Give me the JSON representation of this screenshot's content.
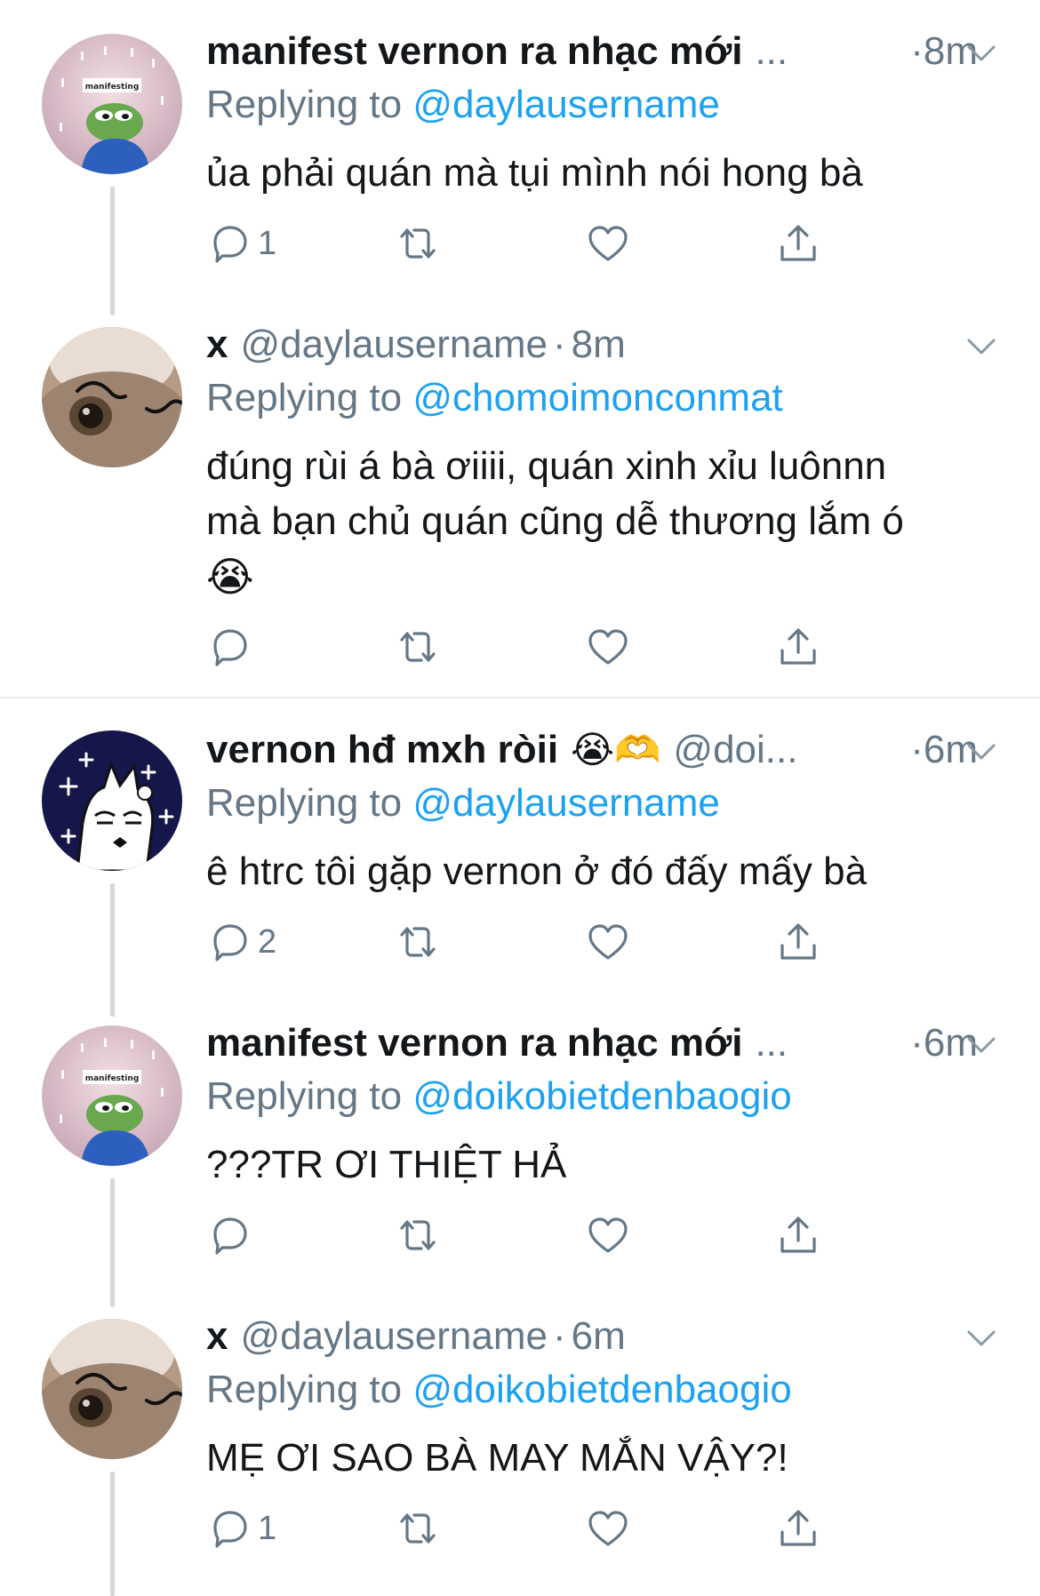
{
  "tweets": [
    {
      "name": "manifest vernon ra nhạc mới",
      "ellipsis": "...",
      "handle": "",
      "time": "8m",
      "replying_label": "Replying to",
      "replying_to": "@daylausername",
      "text": "ủa phải quán mà tụi mình nói hong bà",
      "reply_count": "1",
      "avatar": "pepe-manifesting-avatar",
      "avatar_label": "manifesting"
    },
    {
      "name": "x",
      "handle": "@daylausername",
      "time": "8m",
      "replying_label": "Replying to",
      "replying_to": "@chomoimonconmat",
      "text_line1": "đúng rùi á bà ơiiii, quán xinh xỉu luônnn",
      "text_line2": "mà bạn chủ quán cũng dễ thương lắm ó",
      "text_emoji": "😭",
      "reply_count": "",
      "avatar": "cat-avatar"
    },
    {
      "name": "vernon hđ mxh ròii",
      "name_emojis": "😭🫶",
      "handle": "@doi...",
      "time": "6m",
      "replying_label": "Replying to",
      "replying_to": "@daylausername",
      "text": "ê htrc tôi gặp vernon ở đó đấy mấy bà",
      "reply_count": "2",
      "avatar": "cartoon-girl-avatar"
    },
    {
      "name": "manifest vernon ra nhạc mới",
      "ellipsis": "...",
      "handle": "",
      "time": "6m",
      "replying_label": "Replying to",
      "replying_to": "@doikobietdenbaogio",
      "text": "???TR ƠI THIỆT HẢ",
      "reply_count": "",
      "avatar": "pepe-manifesting-avatar",
      "avatar_label": "manifesting"
    },
    {
      "name": "x",
      "handle": "@daylausername",
      "time": "6m",
      "replying_label": "Replying to",
      "replying_to": "@doikobietdenbaogio",
      "text": "MẸ ƠI SAO BÀ MAY MẮN VẬY?!",
      "reply_count": "1",
      "avatar": "cat-avatar"
    }
  ],
  "separator": "·",
  "colors": {
    "accent": "#1da1f2",
    "muted": "#657786",
    "text": "#14171a",
    "divider": "#e6ecf0"
  },
  "icons": [
    "reply-icon",
    "retweet-icon",
    "like-icon",
    "share-icon",
    "chevron-down-icon"
  ]
}
